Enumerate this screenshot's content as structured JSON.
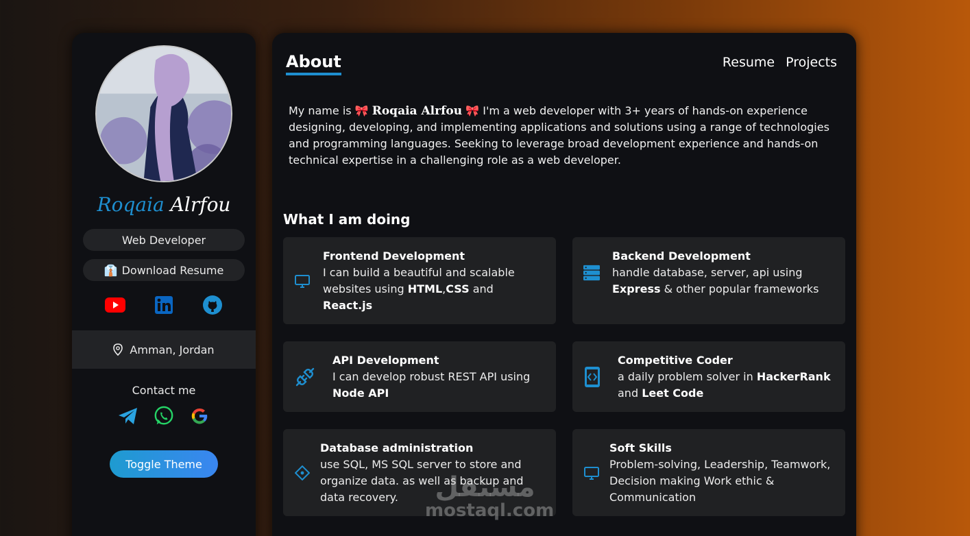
{
  "sidebar": {
    "name_first": "Roqaia",
    "name_last": "Alrfou",
    "role": "Web Developer",
    "download_label": "Download Resume",
    "download_icon": "👔",
    "location": "Amman, Jordan",
    "contact_title": "Contact me",
    "toggle_label": "Toggle Theme",
    "socials": [
      "youtube-icon",
      "linkedin-icon",
      "github-icon"
    ],
    "contacts": [
      "telegram-icon",
      "whatsapp-icon",
      "google-icon"
    ]
  },
  "header": {
    "title": "About",
    "nav": [
      "Resume",
      "Projects"
    ]
  },
  "bio": {
    "prefix": "My name is",
    "bow": "🎀",
    "name": "Roqaia Alrfou",
    "text": "I'm a web developer with 3+ years of hands-on experience designing, developing, and implementing applications and solutions using a range of technologies and programming languages. Seeking to leverage broad development experience and hands-on technical expertise in a challenging role as a web developer."
  },
  "services": {
    "title": "What I am doing",
    "items": [
      {
        "title": "Frontend Development",
        "l1": "I can build a beautiful and scalable websites using ",
        "b1": "HTML",
        "sep": ",",
        "b2": "CSS",
        "l2": " and ",
        "b3": "React.js",
        "icon": "monitor-icon"
      },
      {
        "title": "Backend Development",
        "l1": "handle database, server, api using ",
        "b1": "Express",
        "l2": " & other popular frameworks",
        "icon": "server-icon"
      },
      {
        "title": "API Development",
        "l1": "I can develop robust REST API using ",
        "b1": "Node API",
        "icon": "plug-icon"
      },
      {
        "title": "Competitive Coder",
        "l1": "a daily problem solver in ",
        "b1": "HackerRank",
        "l2": " and ",
        "b2": "Leet Code",
        "icon": "code-phone-icon"
      },
      {
        "title": "Database administration",
        "l1": "use SQL, MS SQL server to store and organize data. as well as backup and data recovery.",
        "icon": "database-icon"
      },
      {
        "title": "Soft Skills",
        "l1": "Problem-solving, Leadership, Teamwork, Decision making Work ethic & Communication",
        "icon": "monitor-icon"
      }
    ]
  },
  "watermark": {
    "ar": "مستقل",
    "en": "mostaql.com"
  },
  "colors": {
    "accent": "#1e8fd0",
    "card": "#202123",
    "panel": "#0f1014"
  }
}
